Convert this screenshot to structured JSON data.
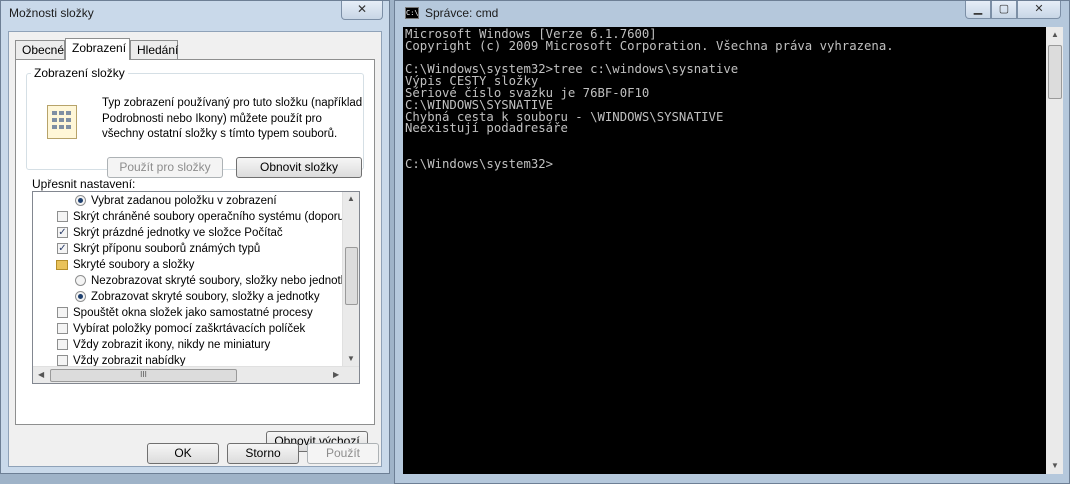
{
  "folder_options": {
    "title": "Možnosti složky",
    "close_glyph": "✕",
    "tabs": [
      "Obecné",
      "Zobrazení",
      "Hledání"
    ],
    "group": {
      "legend": "Zobrazení složky",
      "description": "Typ zobrazení používaný pro tuto složku (například Podrobnosti nebo Ikony) můžete použít pro všechny ostatní složky s tímto typem souborů.",
      "apply_button": "Použít pro složky",
      "reset_button": "Obnovit složky"
    },
    "advanced_label": "Upřesnit nastavení:",
    "advanced_items": [
      {
        "type": "radio",
        "checked": true,
        "label": "Vybrat zadanou položku v zobrazení"
      },
      {
        "type": "checkbox",
        "checked": false,
        "label": "Skrýt chráněné soubory operačního systému (doporučeno)"
      },
      {
        "type": "checkbox",
        "checked": true,
        "label": "Skrýt prázdné jednotky ve složce Počítač"
      },
      {
        "type": "checkbox",
        "checked": true,
        "label": "Skrýt příponu souborů známých typů"
      },
      {
        "type": "folder",
        "label": "Skryté soubory a složky"
      },
      {
        "type": "radio",
        "checked": false,
        "label": "Nezobrazovat skryté soubory, složky nebo jednotky"
      },
      {
        "type": "radio",
        "checked": true,
        "label": "Zobrazovat skryté soubory, složky a jednotky"
      },
      {
        "type": "checkbox",
        "checked": false,
        "label": "Spouštět okna složek jako samostatné procesy"
      },
      {
        "type": "checkbox",
        "checked": false,
        "label": "Vybírat položky pomocí zaškrtávacích políček"
      },
      {
        "type": "checkbox",
        "checked": false,
        "label": "Vždy zobrazit ikony, nikdy ne miniatury"
      },
      {
        "type": "checkbox",
        "checked": false,
        "label": "Vždy zobrazit nabídky"
      }
    ],
    "restore_defaults": "Obnovit výchozí",
    "ok": "OK",
    "cancel": "Storno",
    "apply": "Použít",
    "scroll_thumb_glyph": "III"
  },
  "cmd": {
    "title": "Správce: cmd",
    "icon_text": "C:\\",
    "minimize_glyph": "▁",
    "maximize_glyph": "▢",
    "close_glyph": "✕",
    "lines": [
      "Microsoft Windows [Verze 6.1.7600]",
      "Copyright (c) 2009 Microsoft Corporation. Všechna práva vyhrazena.",
      "",
      "C:\\Windows\\system32>tree c:\\windows\\sysnative",
      "Výpis CESTY složky",
      "Sériové číslo svazku je 76BF-0F10",
      "C:\\WINDOWS\\SYSNATIVE",
      "Chybná cesta k souboru - \\WINDOWS\\SYSNATIVE",
      "Neexistují podadresáře",
      "",
      "",
      "C:\\Windows\\system32>"
    ]
  }
}
